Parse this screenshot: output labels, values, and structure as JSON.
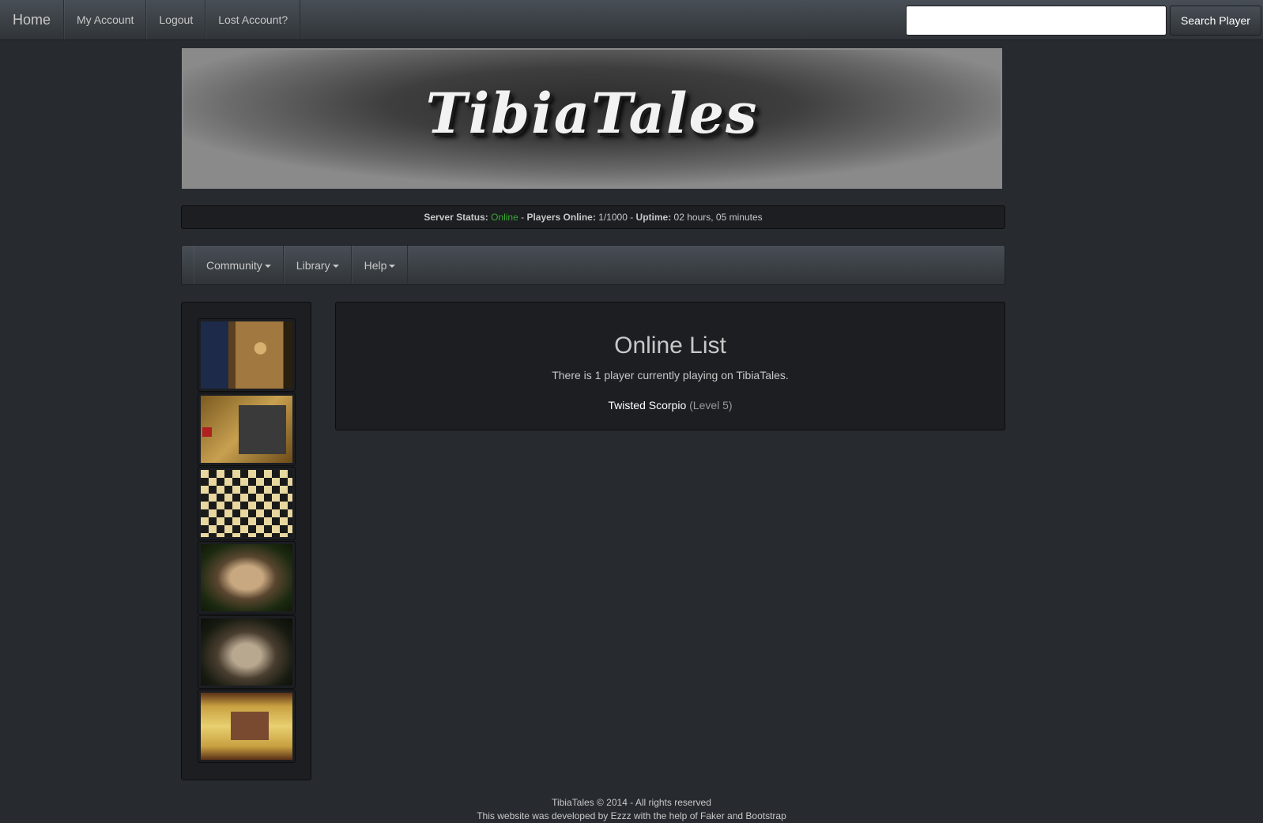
{
  "topnav": {
    "brand": "Home",
    "links": [
      "My Account",
      "Logout",
      "Lost Account?"
    ],
    "search": {
      "placeholder": "",
      "value": "",
      "button": "Search Player"
    }
  },
  "banner": {
    "title": "TibiaTales"
  },
  "status": {
    "server_status_label": "Server Status:",
    "server_status_value": "Online",
    "sep1": " - ",
    "players_label": "Players Online:",
    "players_value": " 1/1000",
    "sep2": " - ",
    "uptime_label": "Uptime:",
    "uptime_value": " 02 hours, 05 minutes"
  },
  "menu": {
    "items": [
      "Community",
      "Library",
      "Help"
    ]
  },
  "sidebar": {
    "thumbnails": [
      "screenshot-1",
      "screenshot-2",
      "screenshot-3",
      "screenshot-4",
      "screenshot-5",
      "screenshot-6"
    ]
  },
  "content": {
    "title": "Online List",
    "subtitle": "There is 1 player currently playing on TibiaTales.",
    "player_name": "Twisted Scorpio",
    "player_level": "(Level 5)"
  },
  "footer": {
    "line1": "TibiaTales © 2014 - All rights reserved",
    "line2": "This website was developed by Ezzz with the help of Faker and Bootstrap"
  },
  "colors": {
    "background": "#272b30",
    "panel": "#1c1e22",
    "online": "#3aa832"
  }
}
